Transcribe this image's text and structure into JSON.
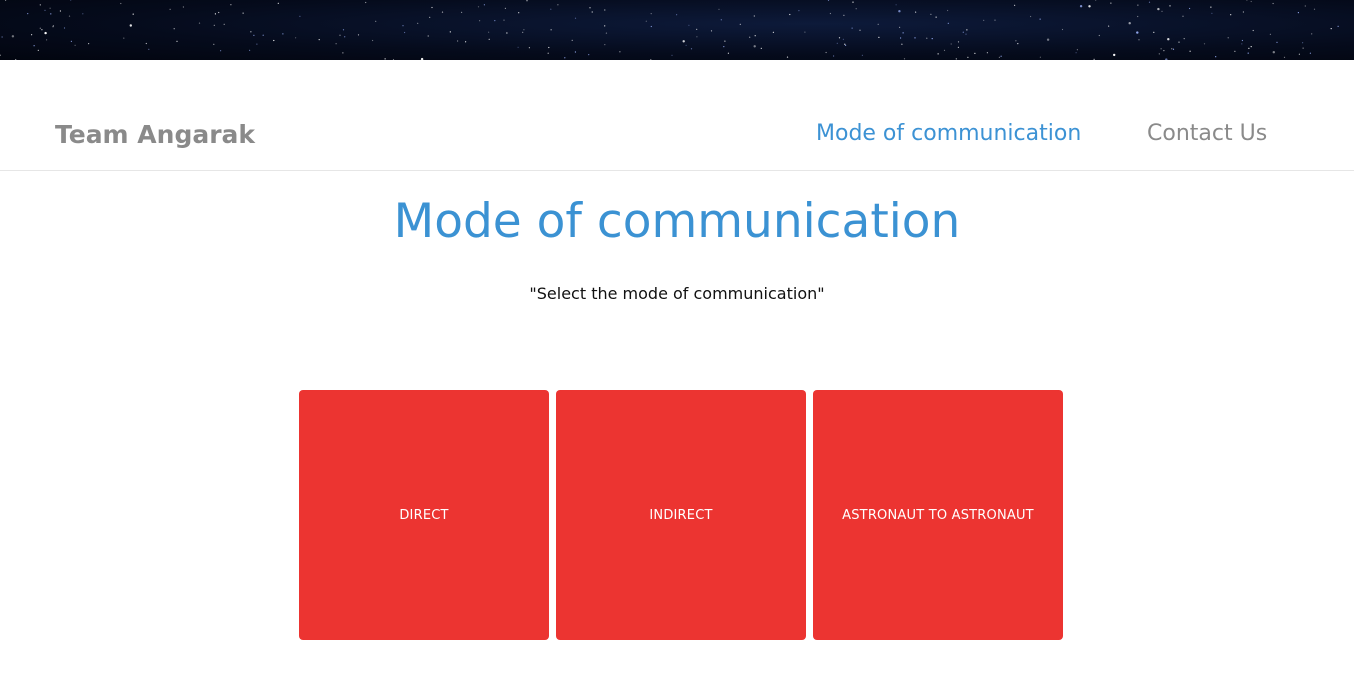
{
  "navbar": {
    "brand": "Team Angarak",
    "links": [
      {
        "label": "Mode of communication",
        "active": true
      },
      {
        "label": "Contact Us",
        "active": false
      }
    ]
  },
  "main": {
    "title": "Mode of communication",
    "subtitle": "\"Select the mode of communication\""
  },
  "options": [
    {
      "label": "DIRECT"
    },
    {
      "label": "INDIRECT"
    },
    {
      "label": "ASTRONAUT TO ASTRONAUT"
    }
  ],
  "colors": {
    "accent": "#3b92d3",
    "tile": "#ec3431",
    "nav_text": "#8a8a8a",
    "banner": "#050b1c"
  }
}
